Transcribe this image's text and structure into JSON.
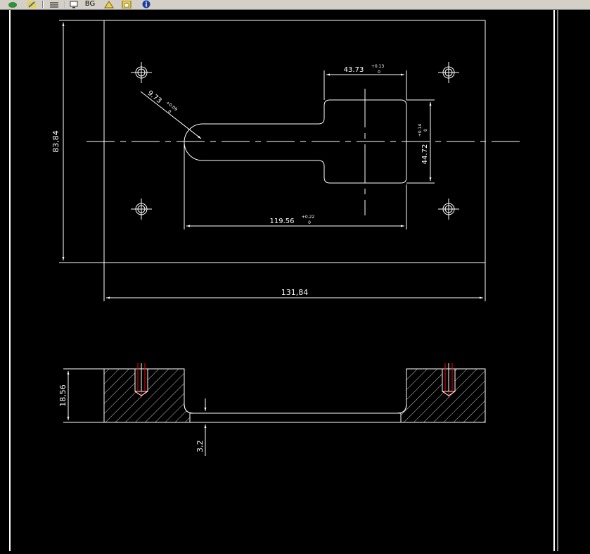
{
  "toolbar": {
    "bg_label": "BG",
    "icons": [
      "eye-icon",
      "pin-icon",
      "layers-icon",
      "monitor-icon",
      "bg-button",
      "layer-triangle-icon",
      "home-icon",
      "info-icon"
    ]
  },
  "drawing": {
    "colors": {
      "background": "#000000",
      "lines": "#ffffff",
      "hidden": "#ff0000"
    },
    "top_view": {
      "height": "83,84",
      "width": "131,84",
      "radius": "9.73",
      "radius_tol_upper": "+0.09",
      "radius_tol_lower": "0",
      "slot_length": "119.56",
      "slot_length_tol_upper": "+0.22",
      "slot_length_tol_lower": "0",
      "pocket_width": "43.73",
      "pocket_width_tol_upper": "+0.13",
      "pocket_width_tol_lower": "0",
      "pocket_height": "44.72",
      "pocket_height_tol_upper": "+0.14",
      "pocket_height_tol_lower": "0"
    },
    "section_view": {
      "thickness": "18,56",
      "floor": "3,2"
    }
  }
}
